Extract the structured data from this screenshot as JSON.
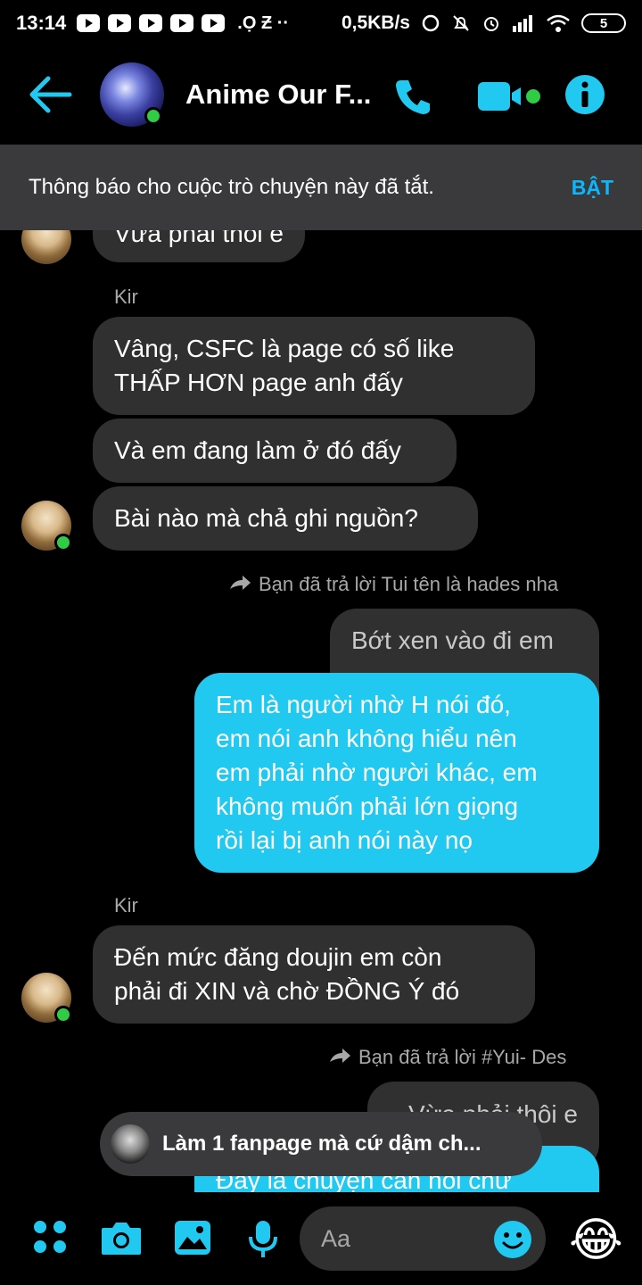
{
  "status_bar": {
    "time": "13:14",
    "misc": ".Ọ Ƶ  ··",
    "speed": "0,5KB/s",
    "battery": "5"
  },
  "header": {
    "title": "Anime Our F...",
    "accent": "#21c8f0"
  },
  "notice": {
    "text": "Thông báo cho cuộc trò chuyện này đã tắt.",
    "action": "BẬT"
  },
  "messages": {
    "m0": "Vừa phải thôi e",
    "sender1": "Kir",
    "m1_l1": "Vâng, CSFC là page có số like",
    "m1_l2": "THẤP HƠN page anh đấy",
    "m2": "Và em đang làm ở đó đấy",
    "m3": "Bài nào mà chả ghi nguồn?",
    "reply1": "Bạn đã trả lời Tui tên là hades nha",
    "m4": "Bớt xen vào đi em",
    "m5_l1": "Em là người nhờ H nói đó,",
    "m5_l2": "em nói anh không hiểu nên",
    "m5_l3": "em phải nhờ người khác, em",
    "m5_l4": "không muốn phải lớn giọng",
    "m5_l5": "rồi lại bị anh nói này nọ",
    "sender2": "Kir",
    "m6_l1": "Đến mức đăng doujin em còn",
    "m6_l2": "phải đi XIN và chờ ĐỒNG Ý đó",
    "reply2": "Bạn đã trả lời #Yui- Des",
    "m7": "Vừa phải thôi e",
    "m8": "Đây là chuyện cần nói chứ"
  },
  "toast": {
    "text": "Làm 1 fanpage mà cứ dậm ch..."
  },
  "composer": {
    "placeholder": "Aa",
    "quick_reaction": "😂"
  }
}
